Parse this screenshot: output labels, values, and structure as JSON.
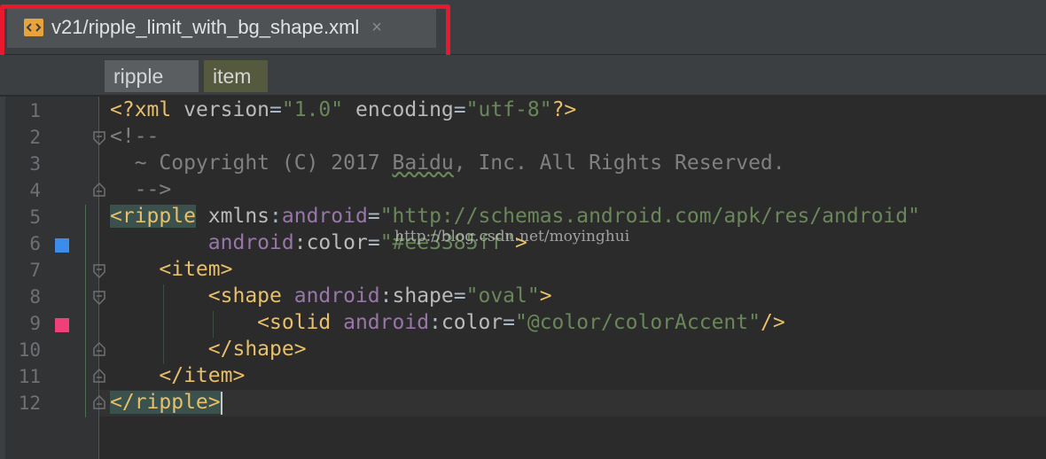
{
  "tab": {
    "title": "v21/ripple_limit_with_bg_shape.xml",
    "close_glyph": "×",
    "icon": "xml-file-icon"
  },
  "breadcrumb": [
    "ripple",
    "item"
  ],
  "line_numbers": [
    "1",
    "2",
    "3",
    "4",
    "5",
    "6",
    "7",
    "8",
    "9",
    "10",
    "11",
    "12"
  ],
  "code": {
    "l1": {
      "open": "<?xml ",
      "a1": "version",
      "eq1": "=",
      "v1": "\"1.0\"",
      "a2": " encoding",
      "eq2": "=",
      "v2": "\"utf-8\"",
      "close": "?>"
    },
    "l2": {
      "text": "<!--"
    },
    "l3": {
      "pre": "  ~ Copyright (C) 2017 ",
      "word": "Baidu",
      "post": ", Inc. All Rights Reserved."
    },
    "l4": {
      "text": "  -->"
    },
    "l5": {
      "tag": "<ripple",
      "a": " xmlns",
      "colon": ":",
      "ns": "android",
      "eq": "=",
      "v": "\"http://schemas.android.com/apk/res/android\""
    },
    "l6": {
      "ind": "        ",
      "ns": "android",
      "colon": ":",
      "a": "color",
      "eq": "=",
      "v": "\"#ee3385ff\"",
      "close": ">"
    },
    "l7": {
      "ind": "    ",
      "tag": "<item>"
    },
    "l8": {
      "ind": "        ",
      "tag": "<shape ",
      "ns": "android",
      "colon": ":",
      "a": "shape",
      "eq": "=",
      "v": "\"oval\"",
      "close": ">"
    },
    "l9": {
      "ind": "            ",
      "tag": "<solid ",
      "ns": "android",
      "colon": ":",
      "a": "color",
      "eq": "=",
      "v": "\"@color/colorAccent\"",
      "close": "/>"
    },
    "l10": {
      "ind": "        ",
      "tag": "</shape>"
    },
    "l11": {
      "ind": "    ",
      "tag": "</item>"
    },
    "l12": {
      "tag": "</ripple>"
    }
  },
  "watermark": "http://blog.csdn.net/moyinghui",
  "colors": {
    "line6_marker": "#3a8de8",
    "line9_marker": "#f0407a",
    "highlight_box": "#e8192c"
  }
}
